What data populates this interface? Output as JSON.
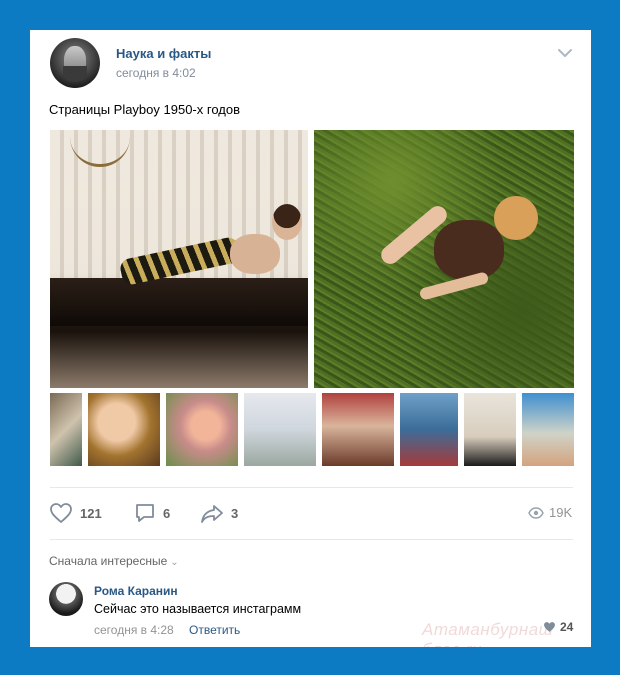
{
  "post": {
    "author": "Наука и факты",
    "time": "сегодня в 4:02",
    "text": "Страницы Playboy 1950-х годов"
  },
  "actions": {
    "likes": "121",
    "comments": "6",
    "shares": "3",
    "views": "19K"
  },
  "comments_section": {
    "sort_label": "Сначала интересные",
    "comment": {
      "author": "Рома Каранин",
      "text": "Сейчас это называется инстаграмм",
      "time": "сегодня в 4:28",
      "reply_label": "Ответить",
      "likes": "24"
    }
  },
  "watermark": "Атаманбурнаш блог.ru",
  "colors": {
    "background": "#0d7bc4",
    "card": "#ffffff",
    "link": "#2a5885",
    "meta": "#818c99"
  },
  "icons": [
    "chevron-down-icon",
    "heart-icon",
    "comment-icon",
    "share-icon",
    "eye-icon"
  ]
}
